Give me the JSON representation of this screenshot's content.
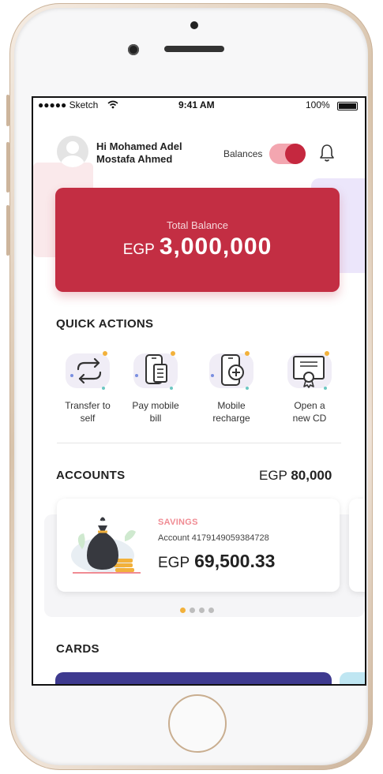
{
  "status_bar": {
    "carrier": "●●●●● Sketch",
    "time": "9:41 AM",
    "battery": "100%"
  },
  "header": {
    "greeting_line1": "Hi Mohamed Adel",
    "greeting_line2": "Mostafa Ahmed",
    "balances_label": "Balances",
    "balances_toggle_on": true
  },
  "balance_card": {
    "label": "Total Balance",
    "currency": "EGP",
    "amount": "3,000,000"
  },
  "quick_actions": {
    "title": "QUICK ACTIONS",
    "items": [
      {
        "line1": "Transfer to",
        "line2": "self",
        "icon": "transfer-icon"
      },
      {
        "line1": "Pay mobile",
        "line2": "bill",
        "icon": "mobile-bill-icon"
      },
      {
        "line1": "Mobile",
        "line2": "recharge",
        "icon": "mobile-recharge-icon"
      },
      {
        "line1": "Open a",
        "line2": "new CD",
        "icon": "certificate-icon"
      }
    ]
  },
  "accounts": {
    "title": "ACCOUNTS",
    "total_currency": "EGP",
    "total_amount": "80,000",
    "card": {
      "type": "SAVINGS",
      "account_number": "Account 4179149059384728",
      "currency": "EGP",
      "amount": "69,500.33"
    },
    "pager_count": 4,
    "pager_active": 0
  },
  "cards": {
    "title": "CARDS"
  },
  "colors": {
    "primary": "#c32e43",
    "accent_yellow": "#f2b13b",
    "savings_label": "#f08b93",
    "card_strip": "#3e3a8f"
  }
}
